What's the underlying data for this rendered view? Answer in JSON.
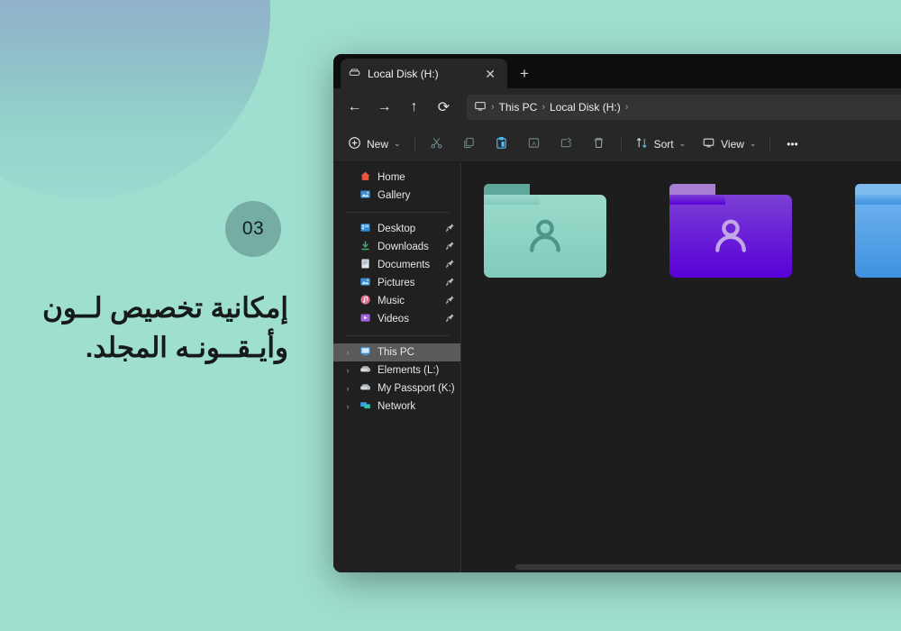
{
  "slide": {
    "number": "03",
    "headline": "إمكانية تخصيص لــون وأيـقــونـه المجلد.",
    "background_color": "#9fdfd0",
    "badge_color": "#76ada3",
    "circle_gradient_from": "#8e8fc8",
    "circle_gradient_to": "#9adbd0"
  },
  "window": {
    "tab": {
      "title": "Local Disk (H:)",
      "icon": "drive-icon",
      "close_icon": "✕"
    },
    "new_tab_label": "+",
    "nav": {
      "back_icon": "←",
      "forward_icon": "→",
      "up_icon": "↑",
      "refresh_icon": "⟳",
      "breadcrumb": {
        "root_icon": "this-pc-icon",
        "separator": "›",
        "items": [
          "This PC",
          "Local Disk (H:)"
        ],
        "trailing_separator": "›"
      }
    },
    "toolbar": {
      "new_label": "New",
      "new_icon": "plus-circle-icon",
      "chevron": "⌄",
      "cut_icon": "scissors-icon",
      "copy_icon": "copy-icon",
      "paste_icon": "paste-icon",
      "rename_icon": "rename-icon",
      "share_icon": "share-icon",
      "delete_icon": "trash-icon",
      "sort_label": "Sort",
      "sort_icon": "sort-arrows-icon",
      "view_label": "View",
      "view_icon": "view-icon",
      "more_label": "•••",
      "accent_color": "#4cc2ff"
    },
    "sidebar": {
      "quick": [
        {
          "label": "Home",
          "icon": "home-icon"
        },
        {
          "label": "Gallery",
          "icon": "gallery-icon"
        }
      ],
      "pinned": [
        {
          "label": "Desktop",
          "icon": "desktop-icon",
          "pin": "📌"
        },
        {
          "label": "Downloads",
          "icon": "download-icon",
          "pin": "📌"
        },
        {
          "label": "Documents",
          "icon": "documents-icon",
          "pin": "📌"
        },
        {
          "label": "Pictures",
          "icon": "pictures-icon",
          "pin": "📌"
        },
        {
          "label": "Music",
          "icon": "music-icon",
          "pin": "📌"
        },
        {
          "label": "Videos",
          "icon": "videos-icon",
          "pin": "📌"
        }
      ],
      "drives": [
        {
          "label": "This PC",
          "icon": "this-pc-icon",
          "expander": "›",
          "selected": true
        },
        {
          "label": "Elements (L:)",
          "icon": "drive-icon",
          "expander": "›",
          "selected": false
        },
        {
          "label": "My Passport (K:)",
          "icon": "drive-icon",
          "expander": "›",
          "selected": false
        },
        {
          "label": "Network",
          "icon": "network-icon",
          "expander": "›",
          "selected": false
        }
      ],
      "selected_row_color": "#5a5a5a"
    },
    "folders": [
      {
        "name": "teal-folder",
        "body_color": "#8fd4c5",
        "tab_color": "#5fa79a",
        "glyph": "person-icon",
        "glyph_color": "#4f948a"
      },
      {
        "name": "purple-folder",
        "body_color": "#6a24d6",
        "tab_color": "#a87fd4",
        "glyph": "person-icon",
        "glyph_color": "#c2a6e8"
      },
      {
        "name": "blue-folder",
        "body_color": "#4f9fe8",
        "tab_color": "#7ebcf0",
        "glyph": "person-icon",
        "glyph_color": "#a8d3f5"
      }
    ]
  }
}
